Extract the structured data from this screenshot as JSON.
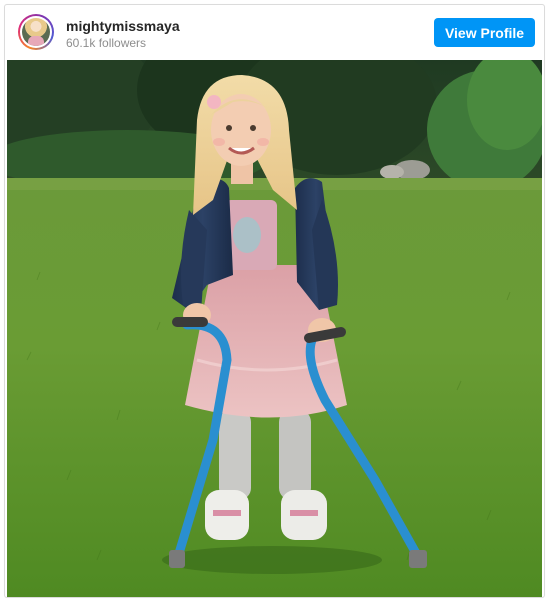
{
  "profile": {
    "username": "mightymissmaya",
    "followers": "60.1k followers",
    "avatar_icon": "profile-avatar"
  },
  "actions": {
    "view_profile_label": "View Profile"
  },
  "colors": {
    "button_blue": "#0095f6",
    "text_dark": "#262626",
    "text_muted": "#8e8e8e",
    "border": "#dbdbdb"
  },
  "post": {
    "media_type": "photo"
  }
}
